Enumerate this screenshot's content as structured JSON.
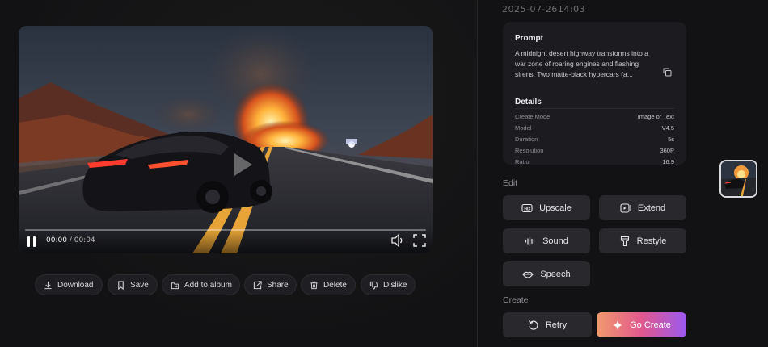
{
  "player": {
    "current_time": "00:00",
    "duration": "00:04",
    "progress": 0
  },
  "actions": [
    {
      "label": "Download",
      "icon": "download-icon"
    },
    {
      "label": "Save",
      "icon": "bookmark-icon"
    },
    {
      "label": "Add to album",
      "icon": "album-add-icon"
    },
    {
      "label": "Share",
      "icon": "share-icon"
    },
    {
      "label": "Delete",
      "icon": "trash-icon"
    },
    {
      "label": "Dislike",
      "icon": "thumbs-down-icon"
    }
  ],
  "info": {
    "timestamp": "2025-07-2614:03",
    "prompt_title": "Prompt",
    "prompt_text": "A midnight desert highway transforms into a war zone of roaring engines and flashing sirens. Two matte-black hypercars (a...",
    "details_title": "Details",
    "details": [
      {
        "key": "Create Mode",
        "value": "Image or Text"
      },
      {
        "key": "Model",
        "value": "V4.5"
      },
      {
        "key": "Duration",
        "value": "5s"
      },
      {
        "key": "Resolution",
        "value": "360P"
      },
      {
        "key": "Ratio",
        "value": "16:9"
      }
    ]
  },
  "edit": {
    "label": "Edit",
    "tools": [
      {
        "label": "Upscale",
        "icon": "hd-icon"
      },
      {
        "label": "Extend",
        "icon": "extend-icon"
      },
      {
        "label": "Sound",
        "icon": "waveform-icon"
      },
      {
        "label": "Restyle",
        "icon": "brush-icon"
      },
      {
        "label": "Speech",
        "icon": "lips-icon"
      }
    ]
  },
  "create": {
    "label": "Create",
    "retry_label": "Retry",
    "go_label": "Go Create"
  },
  "colors": {
    "background": "#121214",
    "card": "#1c1c20",
    "button": "#29292d",
    "accent_gradient": [
      "#f19a6c",
      "#e1588e",
      "#9b59f0"
    ]
  }
}
